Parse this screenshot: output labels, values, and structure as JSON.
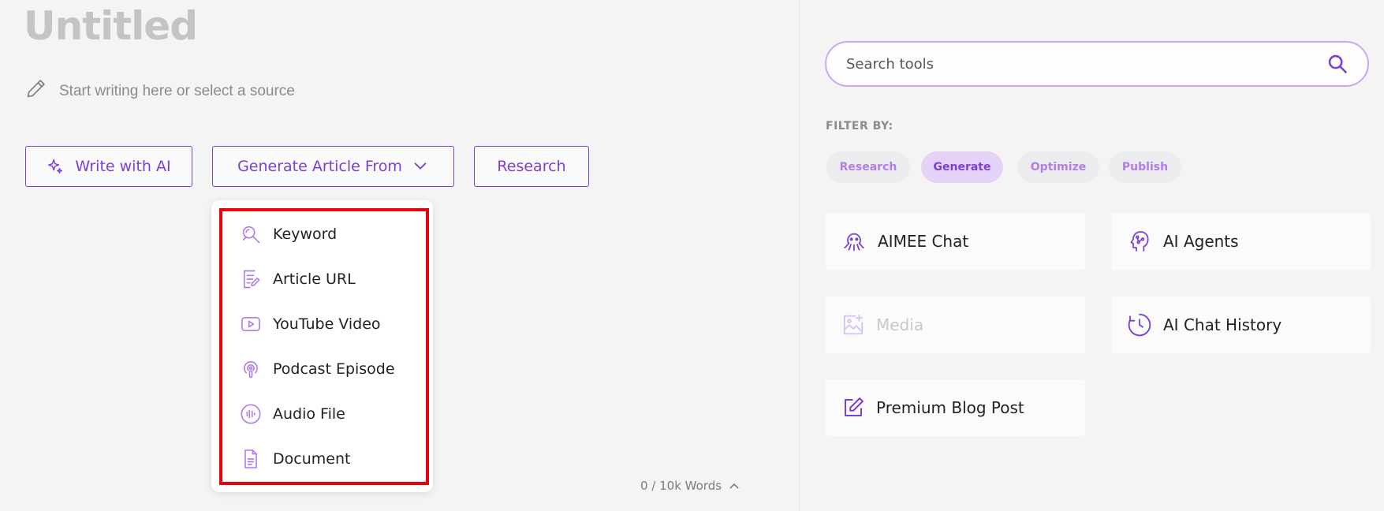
{
  "editor": {
    "title": "Untitled",
    "placeholder": "Start writing here or select a source",
    "buttons": {
      "write_with_ai": "Write with AI",
      "generate_article_from": "Generate Article From",
      "research": "Research"
    },
    "dropdown": {
      "items": [
        {
          "label": "Keyword",
          "icon": "keyword-search-icon"
        },
        {
          "label": "Article URL",
          "icon": "article-edit-icon"
        },
        {
          "label": "YouTube Video",
          "icon": "video-play-icon"
        },
        {
          "label": "Podcast Episode",
          "icon": "podcast-icon"
        },
        {
          "label": "Audio File",
          "icon": "audio-wave-icon"
        },
        {
          "label": "Document",
          "icon": "document-icon"
        }
      ]
    },
    "word_count": "0 / 10k Words"
  },
  "sidebar": {
    "search": {
      "placeholder": "Search tools",
      "value": ""
    },
    "filter_label": "FILTER BY:",
    "filters": [
      "Research",
      "Generate",
      "Optimize",
      "Publish"
    ],
    "active_filter": "Generate",
    "tools": [
      {
        "label": "AIMEE Chat",
        "icon": "octopus-icon",
        "enabled": true
      },
      {
        "label": "AI Agents",
        "icon": "agent-brain-icon",
        "enabled": true
      },
      {
        "label": "Media",
        "icon": "image-add-icon",
        "enabled": false
      },
      {
        "label": "AI Chat History",
        "icon": "history-clock-icon",
        "enabled": true
      },
      {
        "label": "Premium Blog Post",
        "icon": "edit-square-icon",
        "enabled": true
      }
    ]
  },
  "colors": {
    "accent": "#7b3fd4",
    "accent_light": "#b07ee8",
    "highlight_frame": "#e8000b",
    "title_gray": "#c4c4c6"
  }
}
